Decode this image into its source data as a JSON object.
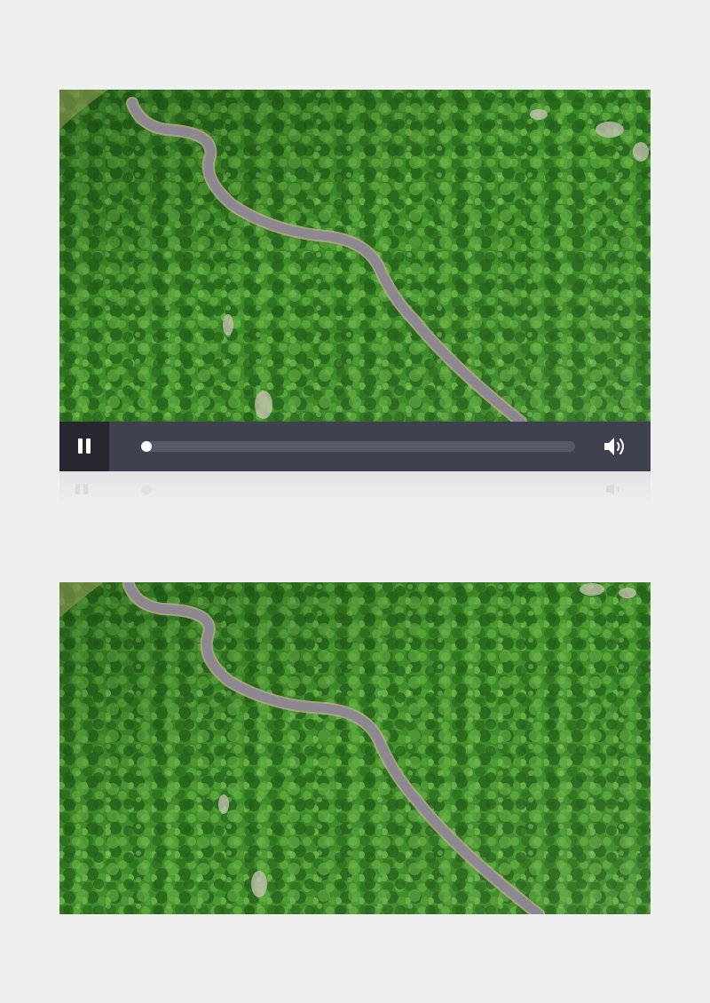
{
  "player": {
    "state": "paused",
    "progress": 0.0,
    "colors": {
      "control_bar": "#3f4150",
      "pause_button_bg": "#26272f",
      "track": "#565867",
      "thumb": "#ffffff",
      "forest": "#3f8a2a",
      "road": "#8c8791"
    },
    "icons": {
      "play_pause": "pause-icon",
      "volume": "volume-icon"
    }
  }
}
